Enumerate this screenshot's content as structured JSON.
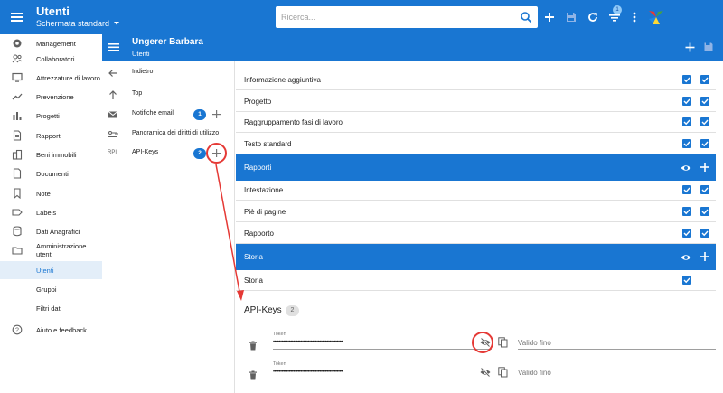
{
  "topbar": {
    "title": "Utenti",
    "subtitle": "Schermata standard",
    "search_placeholder": "Ricerca...",
    "notification_count": "1",
    "icons": [
      "menu-icon",
      "search-icon",
      "plus-icon",
      "save-icon",
      "refresh-icon",
      "filter-list-icon",
      "more-vert-icon",
      "app-logo"
    ]
  },
  "sidebar": {
    "items": [
      {
        "label": "Management",
        "icon": "cog-icon"
      },
      {
        "label": "Collaboratori",
        "icon": "people-icon"
      },
      {
        "label": "Attrezzature di lavoro",
        "icon": "monitor-icon"
      },
      {
        "label": "Prevenzione",
        "icon": "trend-icon"
      },
      {
        "label": "Progetti",
        "icon": "bar-chart-icon"
      },
      {
        "label": "Rapporti",
        "icon": "report-icon"
      },
      {
        "label": "Beni immobili",
        "icon": "building-icon"
      },
      {
        "label": "Documenti",
        "icon": "document-icon"
      },
      {
        "label": "Note",
        "icon": "bookmark-icon"
      },
      {
        "label": "Labels",
        "icon": "label-icon"
      },
      {
        "label": "Dati Anagrafici",
        "icon": "database-icon"
      },
      {
        "label": "Amministrazione utenti",
        "icon": "folder-icon"
      },
      {
        "label": "Utenti",
        "icon": ""
      },
      {
        "label": "Gruppi",
        "icon": ""
      },
      {
        "label": "Filtri dati",
        "icon": ""
      },
      {
        "label": "Aiuto e feedback",
        "icon": "help-icon"
      }
    ]
  },
  "panel": {
    "name": "Ungerer Barbara",
    "sub": "Utenti",
    "items": [
      {
        "label": "Indietro",
        "icon": "arrow-back-icon"
      },
      {
        "label": "Top",
        "icon": "arrow-up-icon"
      },
      {
        "label": "Notifiche email",
        "icon": "email-icon",
        "count": "1"
      },
      {
        "label": "Panoramica dei diritti di utilizzo",
        "icon": "rights-icon"
      },
      {
        "label": "API-Keys",
        "icon": "api-icon",
        "icon_text": "RPI",
        "count": "2"
      }
    ]
  },
  "main": {
    "rows1": [
      "Informazione aggiuntiva",
      "Progetto",
      "Raggruppamento fasi di lavoro",
      "Testo standard"
    ],
    "section_rapporti": "Rapporti",
    "rows2": [
      "Intestazione",
      "Piè di pagine",
      "Rapporto"
    ],
    "section_storia": "Storia",
    "rows3": [
      "Storia"
    ],
    "api_title": "API-Keys",
    "api_count": "2",
    "tokens": [
      {
        "label": "Token",
        "value": "••••••••••••••••••••••••••••••••••••••••••••••••",
        "valid_placeholder": "Valido fino"
      },
      {
        "label": "Token",
        "value": "••••••••••••••••••••••••••••••••••••••••••••••••",
        "valid_placeholder": "Valido fino"
      }
    ]
  },
  "colors": {
    "primary": "#1976d2",
    "annotation": "#e53935",
    "selected_bg": "#e3eef9"
  }
}
